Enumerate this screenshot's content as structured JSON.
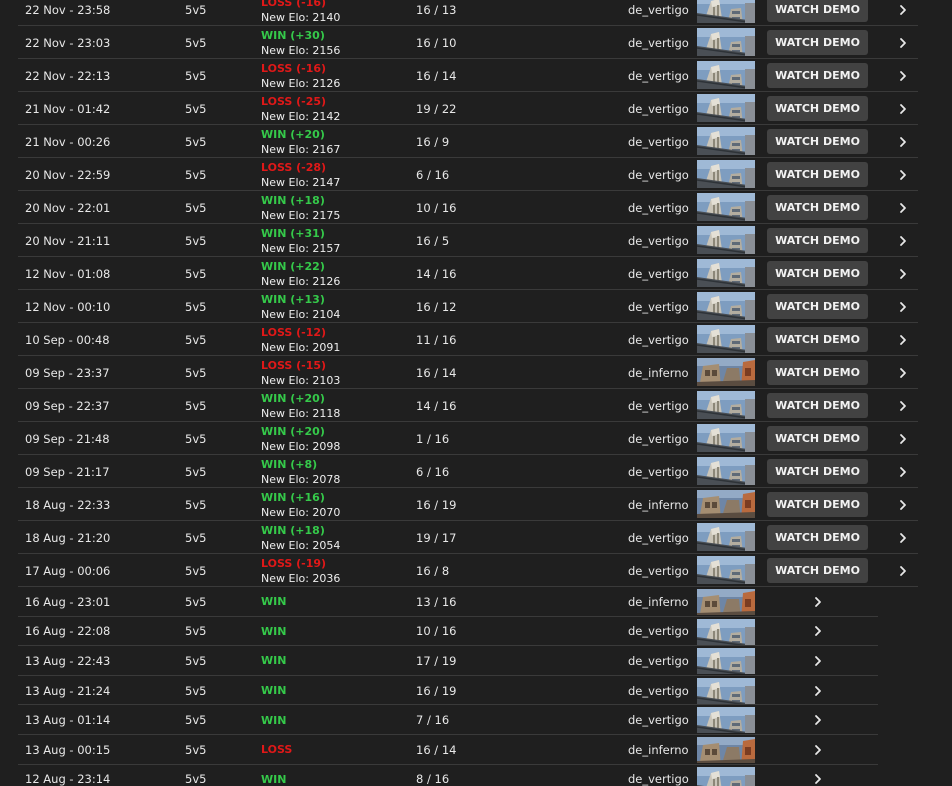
{
  "demo_label": "WATCH DEMO",
  "colors": {
    "win": "#35c94a",
    "loss": "#e01818",
    "background": "#1f1f1f",
    "button": "#424242"
  },
  "matches": [
    {
      "date": "22 Nov - 23:58",
      "mode": "5v5",
      "result": "LOSS (-16)",
      "outcome": "loss",
      "elo": "New Elo: 2140",
      "score": "16 / 13",
      "map": "de_vertigo",
      "demo": true
    },
    {
      "date": "22 Nov - 23:03",
      "mode": "5v5",
      "result": "WIN (+30)",
      "outcome": "win",
      "elo": "New Elo: 2156",
      "score": "16 / 10",
      "map": "de_vertigo",
      "demo": true
    },
    {
      "date": "22 Nov - 22:13",
      "mode": "5v5",
      "result": "LOSS (-16)",
      "outcome": "loss",
      "elo": "New Elo: 2126",
      "score": "16 / 14",
      "map": "de_vertigo",
      "demo": true
    },
    {
      "date": "21 Nov - 01:42",
      "mode": "5v5",
      "result": "LOSS (-25)",
      "outcome": "loss",
      "elo": "New Elo: 2142",
      "score": "19 / 22",
      "map": "de_vertigo",
      "demo": true
    },
    {
      "date": "21 Nov - 00:26",
      "mode": "5v5",
      "result": "WIN (+20)",
      "outcome": "win",
      "elo": "New Elo: 2167",
      "score": "16 / 9",
      "map": "de_vertigo",
      "demo": true
    },
    {
      "date": "20 Nov - 22:59",
      "mode": "5v5",
      "result": "LOSS (-28)",
      "outcome": "loss",
      "elo": "New Elo: 2147",
      "score": "6 / 16",
      "map": "de_vertigo",
      "demo": true
    },
    {
      "date": "20 Nov - 22:01",
      "mode": "5v5",
      "result": "WIN (+18)",
      "outcome": "win",
      "elo": "New Elo: 2175",
      "score": "10 / 16",
      "map": "de_vertigo",
      "demo": true
    },
    {
      "date": "20 Nov - 21:11",
      "mode": "5v5",
      "result": "WIN (+31)",
      "outcome": "win",
      "elo": "New Elo: 2157",
      "score": "16 / 5",
      "map": "de_vertigo",
      "demo": true
    },
    {
      "date": "12 Nov - 01:08",
      "mode": "5v5",
      "result": "WIN (+22)",
      "outcome": "win",
      "elo": "New Elo: 2126",
      "score": "14 / 16",
      "map": "de_vertigo",
      "demo": true
    },
    {
      "date": "12 Nov - 00:10",
      "mode": "5v5",
      "result": "WIN (+13)",
      "outcome": "win",
      "elo": "New Elo: 2104",
      "score": "16 / 12",
      "map": "de_vertigo",
      "demo": true
    },
    {
      "date": "10 Sep - 00:48",
      "mode": "5v5",
      "result": "LOSS (-12)",
      "outcome": "loss",
      "elo": "New Elo: 2091",
      "score": "11 / 16",
      "map": "de_vertigo",
      "demo": true
    },
    {
      "date": "09 Sep - 23:37",
      "mode": "5v5",
      "result": "LOSS (-15)",
      "outcome": "loss",
      "elo": "New Elo: 2103",
      "score": "16 / 14",
      "map": "de_inferno",
      "demo": true
    },
    {
      "date": "09 Sep - 22:37",
      "mode": "5v5",
      "result": "WIN (+20)",
      "outcome": "win",
      "elo": "New Elo: 2118",
      "score": "14 / 16",
      "map": "de_vertigo",
      "demo": true
    },
    {
      "date": "09 Sep - 21:48",
      "mode": "5v5",
      "result": "WIN (+20)",
      "outcome": "win",
      "elo": "New Elo: 2098",
      "score": "1 / 16",
      "map": "de_vertigo",
      "demo": true
    },
    {
      "date": "09 Sep - 21:17",
      "mode": "5v5",
      "result": "WIN (+8)",
      "outcome": "win",
      "elo": "New Elo: 2078",
      "score": "6 / 16",
      "map": "de_vertigo",
      "demo": true
    },
    {
      "date": "18 Aug - 22:33",
      "mode": "5v5",
      "result": "WIN (+16)",
      "outcome": "win",
      "elo": "New Elo: 2070",
      "score": "16 / 19",
      "map": "de_inferno",
      "demo": true
    },
    {
      "date": "18 Aug - 21:20",
      "mode": "5v5",
      "result": "WIN (+18)",
      "outcome": "win",
      "elo": "New Elo: 2054",
      "score": "19 / 17",
      "map": "de_vertigo",
      "demo": true
    },
    {
      "date": "17 Aug - 00:06",
      "mode": "5v5",
      "result": "LOSS (-19)",
      "outcome": "loss",
      "elo": "New Elo: 2036",
      "score": "16 / 8",
      "map": "de_vertigo",
      "demo": true
    },
    {
      "date": "16 Aug - 23:01",
      "mode": "5v5",
      "result": "WIN",
      "outcome": "win",
      "elo": "",
      "score": "13 / 16",
      "map": "de_inferno",
      "demo": false
    },
    {
      "date": "16 Aug - 22:08",
      "mode": "5v5",
      "result": "WIN",
      "outcome": "win",
      "elo": "",
      "score": "10 / 16",
      "map": "de_vertigo",
      "demo": false
    },
    {
      "date": "13 Aug - 22:43",
      "mode": "5v5",
      "result": "WIN",
      "outcome": "win",
      "elo": "",
      "score": "17 / 19",
      "map": "de_vertigo",
      "demo": false
    },
    {
      "date": "13 Aug - 21:24",
      "mode": "5v5",
      "result": "WIN",
      "outcome": "win",
      "elo": "",
      "score": "16 / 19",
      "map": "de_vertigo",
      "demo": false
    },
    {
      "date": "13 Aug - 01:14",
      "mode": "5v5",
      "result": "WIN",
      "outcome": "win",
      "elo": "",
      "score": "7 / 16",
      "map": "de_vertigo",
      "demo": false
    },
    {
      "date": "13 Aug - 00:15",
      "mode": "5v5",
      "result": "LOSS",
      "outcome": "loss",
      "elo": "",
      "score": "16 / 14",
      "map": "de_inferno",
      "demo": false
    },
    {
      "date": "12 Aug - 23:14",
      "mode": "5v5",
      "result": "WIN",
      "outcome": "win",
      "elo": "",
      "score": "8 / 16",
      "map": "de_vertigo",
      "demo": false
    }
  ]
}
